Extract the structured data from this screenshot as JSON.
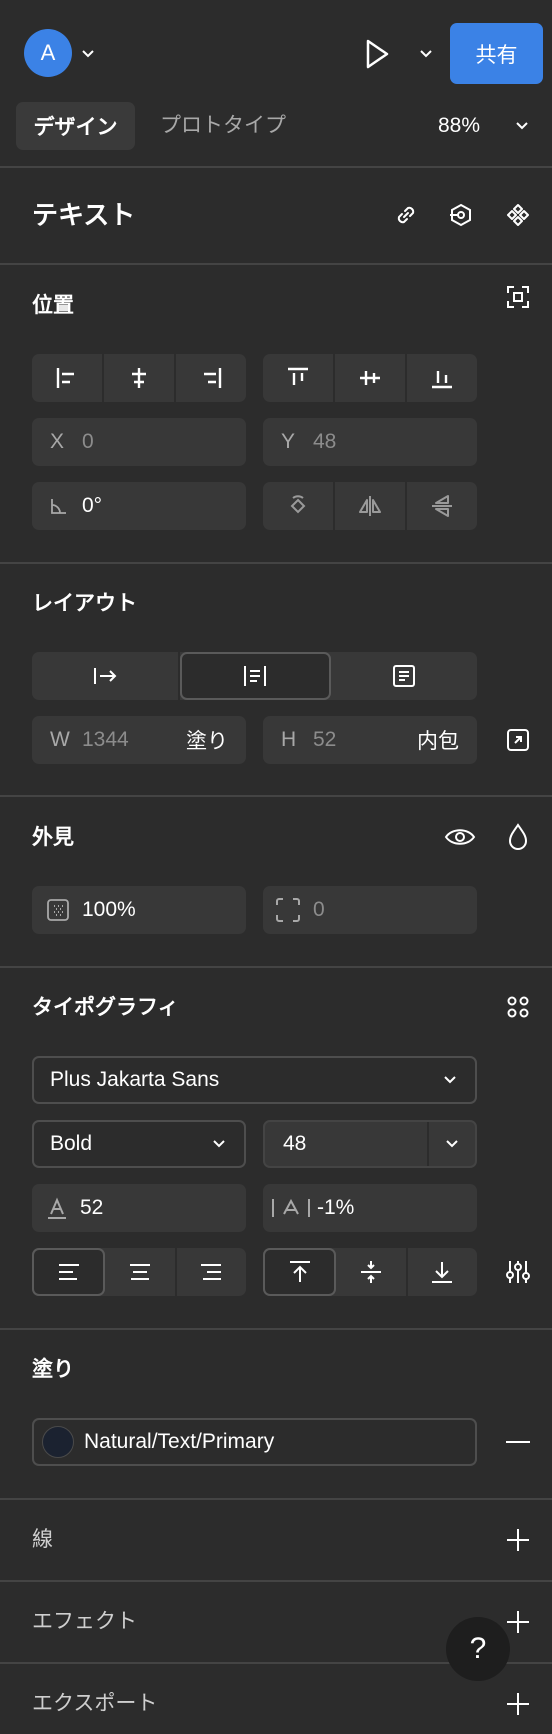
{
  "header": {
    "avatar_letter": "A",
    "share_label": "共有",
    "accent_color": "#3b82e6"
  },
  "tabs": {
    "design": "デザイン",
    "prototype": "プロトタイプ",
    "zoom": "88%"
  },
  "layer": {
    "title": "テキスト"
  },
  "position": {
    "title": "位置",
    "x_label": "X",
    "x_value": "0",
    "y_label": "Y",
    "y_value": "48",
    "rotation_value": "0°"
  },
  "layout": {
    "title": "レイアウト",
    "w_label": "W",
    "w_value": "1344",
    "w_mode": "塗り",
    "h_label": "H",
    "h_value": "52",
    "h_mode": "内包"
  },
  "appearance": {
    "title": "外見",
    "opacity": "100%",
    "corner_radius": "0"
  },
  "typography": {
    "title": "タイポグラフィ",
    "font_family": "Plus Jakarta Sans",
    "font_weight": "Bold",
    "font_size": "48",
    "line_height": "52",
    "letter_spacing": "-1%"
  },
  "fill": {
    "title": "塗り",
    "style_name": "Natural/Text/Primary",
    "swatch_color": "#1b2230"
  },
  "stroke": {
    "title": "線"
  },
  "effects": {
    "title": "エフェクト"
  },
  "export": {
    "title": "エクスポート"
  },
  "help": {
    "label": "?"
  }
}
